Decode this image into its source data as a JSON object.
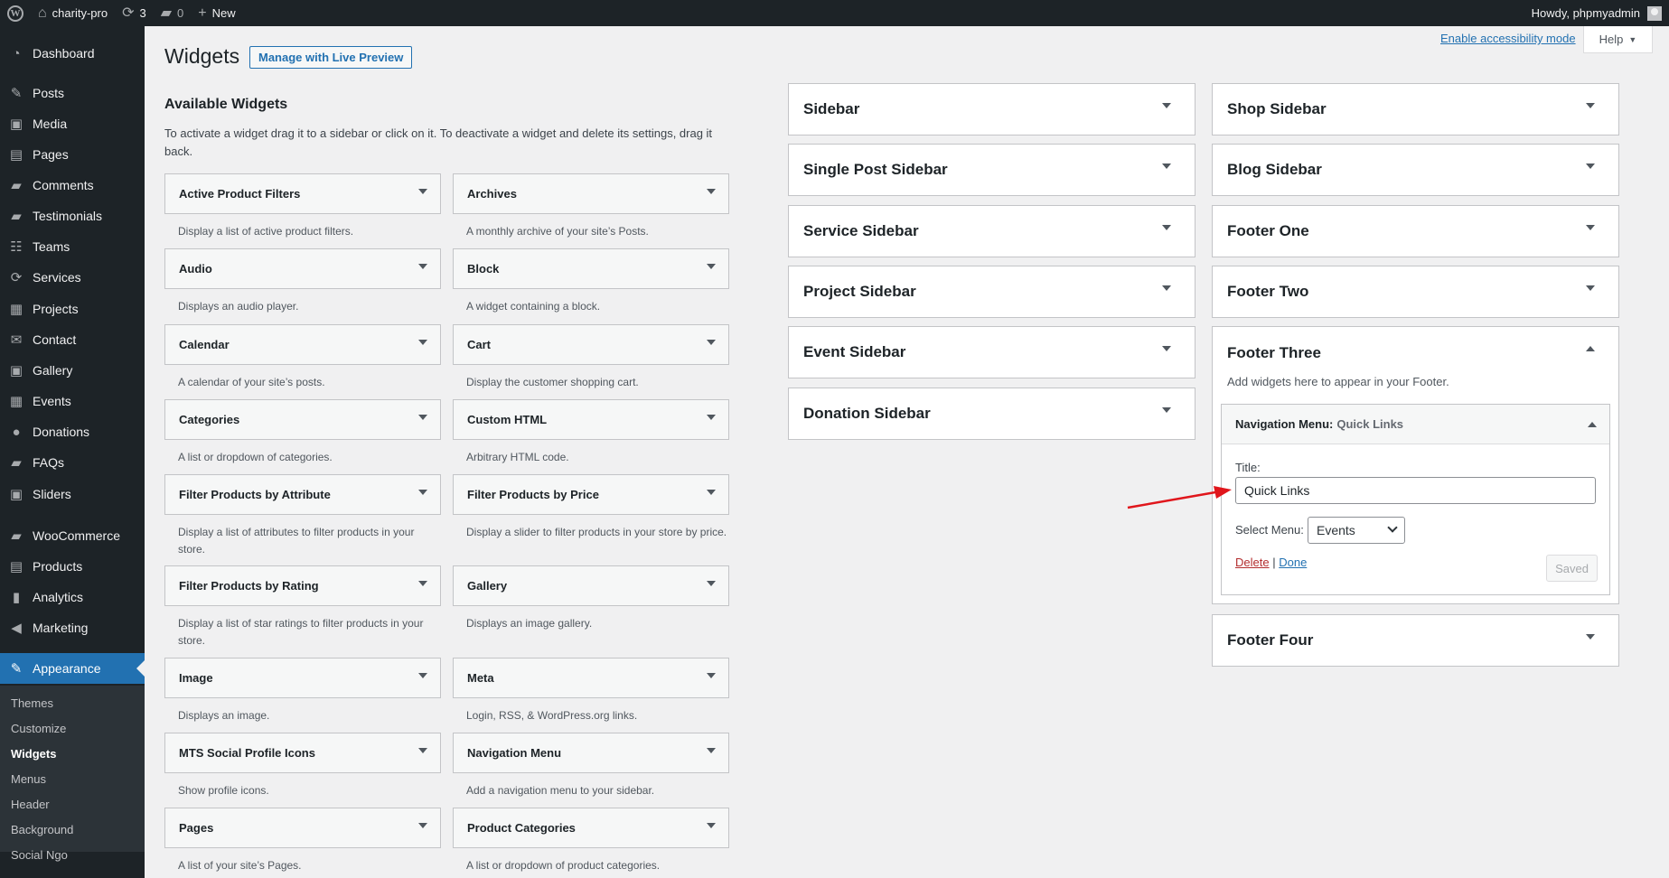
{
  "adminbar": {
    "site_name": "charity-pro",
    "updates_count": "3",
    "comments_count": "0",
    "new_label": "New",
    "howdy": "Howdy, phpmyadmin"
  },
  "menu": {
    "items": [
      {
        "label": "Dashboard",
        "icon": "dashboard-icon",
        "glyph": "◔"
      },
      {
        "label": "Posts",
        "icon": "pin-icon",
        "glyph": "✎"
      },
      {
        "label": "Media",
        "icon": "media-icon",
        "glyph": "▣"
      },
      {
        "label": "Pages",
        "icon": "pages-icon",
        "glyph": "▤"
      },
      {
        "label": "Comments",
        "icon": "comments-icon",
        "glyph": "▰"
      },
      {
        "label": "Testimonials",
        "icon": "testimonials-icon",
        "glyph": "▰"
      },
      {
        "label": "Teams",
        "icon": "teams-icon",
        "glyph": "☷"
      },
      {
        "label": "Services",
        "icon": "services-icon",
        "glyph": "⟳"
      },
      {
        "label": "Projects",
        "icon": "projects-icon",
        "glyph": "▦"
      },
      {
        "label": "Contact",
        "icon": "contact-icon",
        "glyph": "✉"
      },
      {
        "label": "Gallery",
        "icon": "gallery-icon",
        "glyph": "▣"
      },
      {
        "label": "Events",
        "icon": "events-icon",
        "glyph": "▦"
      },
      {
        "label": "Donations",
        "icon": "donations-icon",
        "glyph": "●"
      },
      {
        "label": "FAQs",
        "icon": "faqs-icon",
        "glyph": "▰"
      },
      {
        "label": "Sliders",
        "icon": "sliders-icon",
        "glyph": "▣"
      },
      {
        "label": "WooCommerce",
        "icon": "woocommerce-icon",
        "glyph": "▰"
      },
      {
        "label": "Products",
        "icon": "products-icon",
        "glyph": "▤"
      },
      {
        "label": "Analytics",
        "icon": "analytics-icon",
        "glyph": "▮"
      },
      {
        "label": "Marketing",
        "icon": "marketing-icon",
        "glyph": "◀"
      },
      {
        "label": "Appearance",
        "icon": "brush-icon",
        "glyph": "✎"
      }
    ],
    "submenu": [
      "Themes",
      "Customize",
      "Widgets",
      "Menus",
      "Header",
      "Background",
      "Social Ngo"
    ]
  },
  "header": {
    "title": "Widgets",
    "live_preview": "Manage with Live Preview",
    "accessibility": "Enable accessibility mode",
    "help": "Help"
  },
  "available": {
    "title": "Available Widgets",
    "description": "To activate a widget drag it to a sidebar or click on it. To deactivate a widget and delete its settings, drag it back.",
    "widgets": [
      {
        "name": "Active Product Filters",
        "desc": "Display a list of active product filters."
      },
      {
        "name": "Archives",
        "desc": "A monthly archive of your site’s Posts."
      },
      {
        "name": "Audio",
        "desc": "Displays an audio player."
      },
      {
        "name": "Block",
        "desc": "A widget containing a block."
      },
      {
        "name": "Calendar",
        "desc": "A calendar of your site’s posts."
      },
      {
        "name": "Cart",
        "desc": "Display the customer shopping cart."
      },
      {
        "name": "Categories",
        "desc": "A list or dropdown of categories."
      },
      {
        "name": "Custom HTML",
        "desc": "Arbitrary HTML code."
      },
      {
        "name": "Filter Products by Attribute",
        "desc": "Display a list of attributes to filter products in your store."
      },
      {
        "name": "Filter Products by Price",
        "desc": "Display a slider to filter products in your store by price."
      },
      {
        "name": "Filter Products by Rating",
        "desc": "Display a list of star ratings to filter products in your store."
      },
      {
        "name": "Gallery",
        "desc": "Displays an image gallery."
      },
      {
        "name": "Image",
        "desc": "Displays an image."
      },
      {
        "name": "Meta",
        "desc": "Login, RSS, & WordPress.org links."
      },
      {
        "name": "MTS Social Profile Icons",
        "desc": "Show profile icons."
      },
      {
        "name": "Navigation Menu",
        "desc": "Add a navigation menu to your sidebar."
      },
      {
        "name": "Pages",
        "desc": "A list of your site’s Pages."
      },
      {
        "name": "Product Categories",
        "desc": "A list or dropdown of product categories."
      }
    ]
  },
  "areas": {
    "left": [
      "Sidebar",
      "Single Post Sidebar",
      "Service Sidebar",
      "Project Sidebar",
      "Event Sidebar",
      "Donation Sidebar"
    ],
    "right": [
      "Shop Sidebar",
      "Blog Sidebar",
      "Footer One",
      "Footer Two"
    ],
    "open": {
      "title": "Footer Three",
      "desc": "Add widgets here to appear in your Footer.",
      "widget": {
        "type": "Navigation Menu:",
        "in_title": "Quick Links",
        "title_label": "Title:",
        "title_value": "Quick Links",
        "menu_label": "Select Menu:",
        "menu_value": "Events",
        "delete": "Delete",
        "sep": "|",
        "done": "Done",
        "saved": "Saved"
      }
    },
    "last": "Footer Four"
  },
  "colors": {
    "accent": "#2271b1",
    "adminbar": "#1d2327",
    "annotation": "#e0161c"
  }
}
